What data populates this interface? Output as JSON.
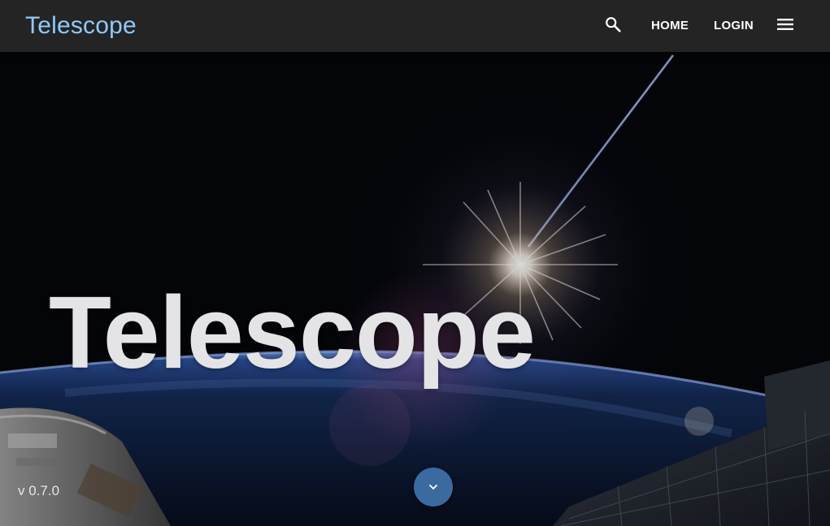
{
  "header": {
    "brand": "Telescope",
    "nav": {
      "home_label": "HOME",
      "login_label": "LOGIN"
    },
    "icons": {
      "search": "search-icon",
      "menu": "menu-icon"
    }
  },
  "hero": {
    "title": "Telescope",
    "version": "v 0.7.0",
    "scroll_icon": "chevron-down-icon"
  },
  "colors": {
    "topbar_bg": "#242424",
    "brand": "#90caf9",
    "scroll_button": "#3b6aa1",
    "hero_title": "#e4e4e6"
  }
}
